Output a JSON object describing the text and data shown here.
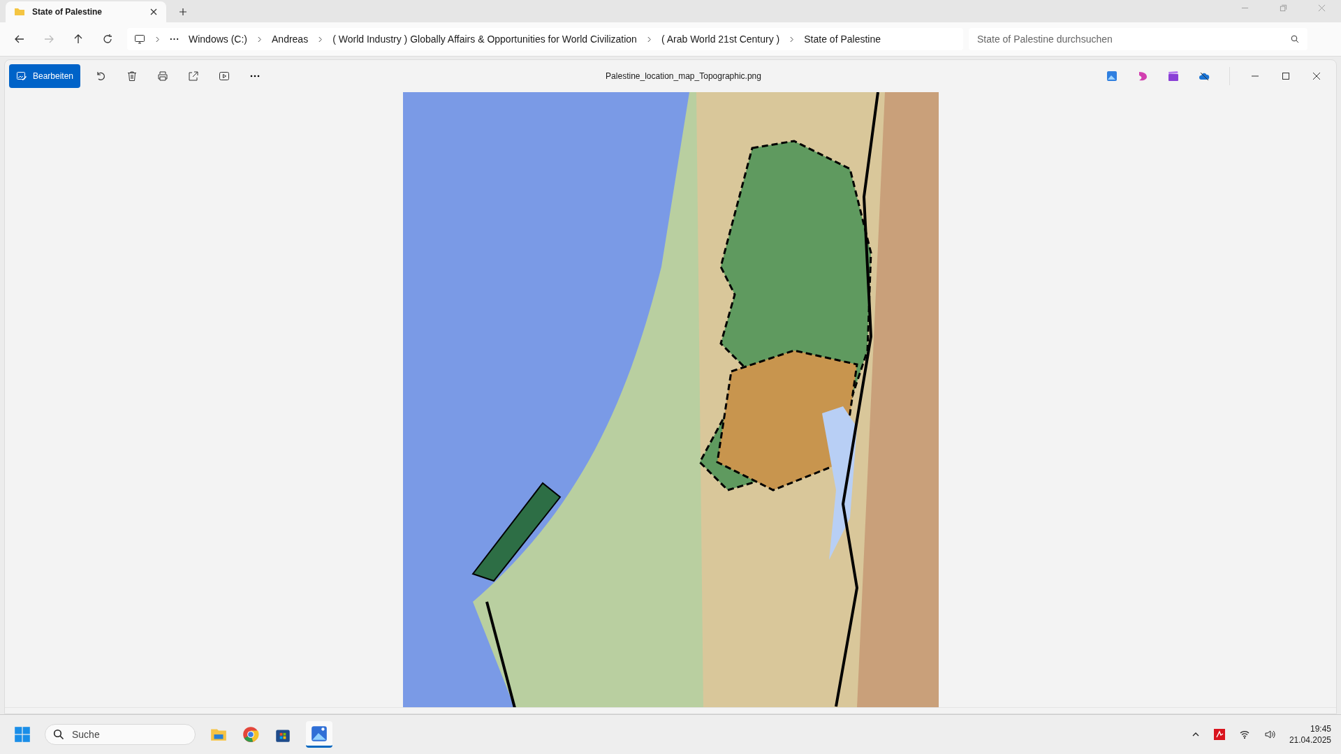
{
  "explorer": {
    "tab": {
      "title": "State of Palestine"
    },
    "breadcrumbs": [
      "Windows (C:)",
      "Andreas",
      "( World Industry ) Globally Affairs & Opportunities for World Civilization",
      "( Arab World 21st Century )",
      "State of Palestine"
    ],
    "search": {
      "placeholder": "State of Palestine durchsuchen"
    }
  },
  "viewer": {
    "edit_button": "Bearbeiten",
    "file_name": "Palestine_location_map_Topographic.png"
  },
  "taskbar": {
    "search": {
      "placeholder": "Suche"
    },
    "time": "19:45",
    "date": "21.04.2025"
  }
}
